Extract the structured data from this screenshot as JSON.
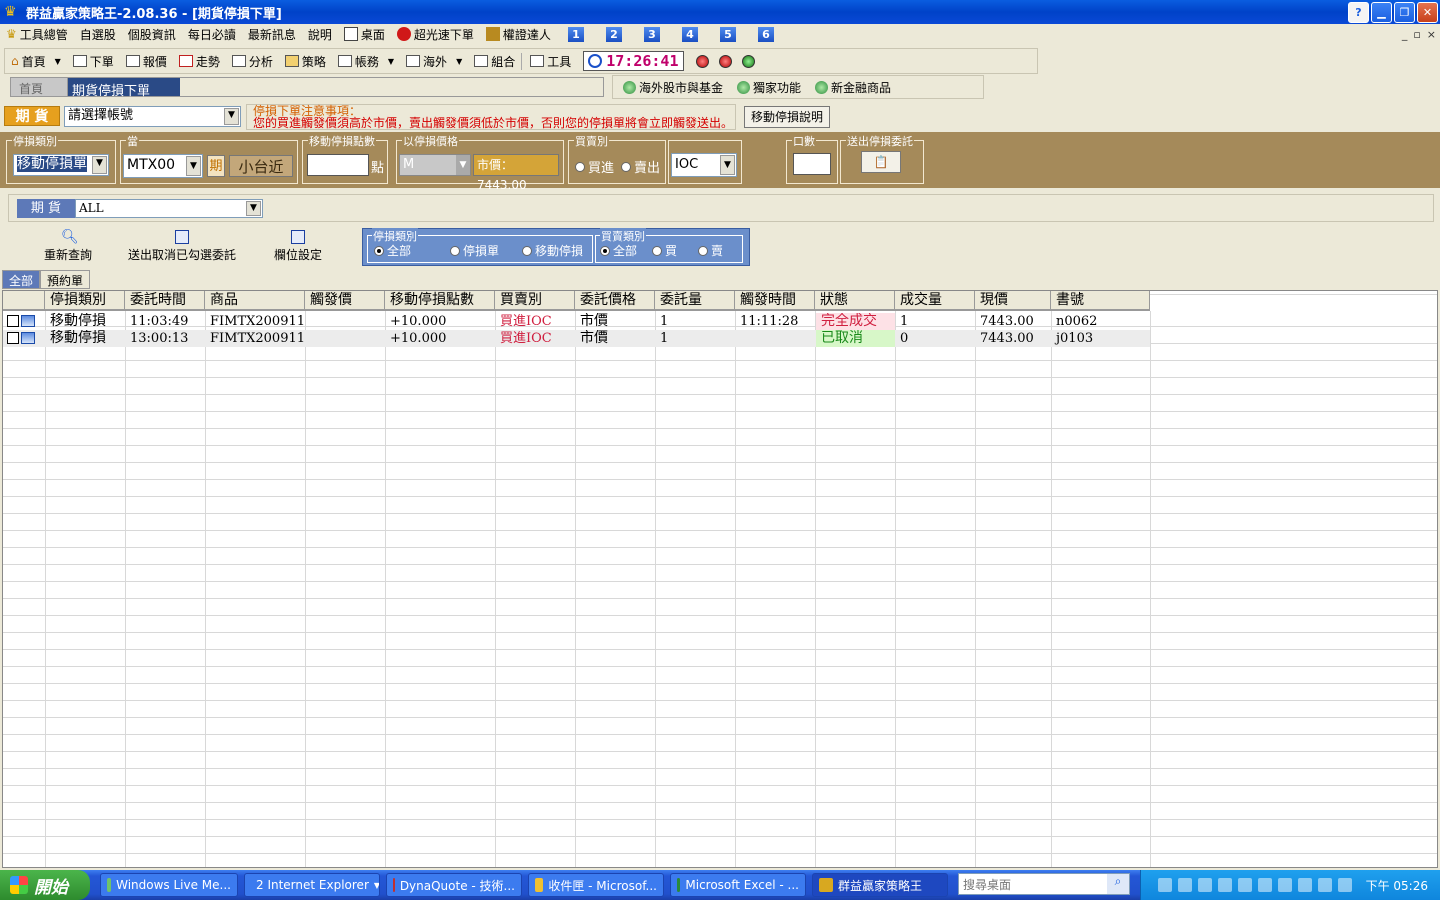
{
  "window": {
    "title": "群益贏家策略王-2.08.36 - [期貨停損下單]",
    "help": "?"
  },
  "menu": {
    "items": [
      "工具總管",
      "自選股",
      "個股資訊",
      "每日必讀",
      "最新訊息",
      "說明",
      "桌面",
      "超光速下單",
      "權證達人"
    ],
    "numbers": [
      "1",
      "2",
      "3",
      "4",
      "5",
      "6"
    ],
    "mdi": [
      "_",
      "▫",
      "×"
    ]
  },
  "toolbar": {
    "items": [
      "首頁",
      "下單",
      "報價",
      "走勢",
      "分析",
      "策略",
      "帳務",
      "海外",
      "組合",
      "工具"
    ],
    "clock": "17:26:41"
  },
  "tabs": {
    "home": "首頁",
    "active": "期貨停損下單"
  },
  "ext_links": [
    "海外股市與基金",
    "獨家功能",
    "新金融商品"
  ],
  "account": {
    "label": "期 貨",
    "select_value": "請選擇帳號",
    "notice_title": "停損下單注意事項：",
    "notice_body": "您的買進觸發價須高於市價，賣出觸發價須低於市價，否則您的停損單將會立即觸發送出。",
    "help_button": "移動停損說明"
  },
  "order": {
    "type_legend": "停損類別",
    "type_value": "移動停損單",
    "product_legend": "當",
    "product_value": "MTX00",
    "period_label": "期",
    "product_name": "小台近",
    "points_legend": "移動停損點數",
    "points_unit": "點",
    "price_legend": "以停損價格",
    "price_mode": "M",
    "market_price": "市價：7443.00",
    "side_legend": "買賣別",
    "buy": "買進",
    "sell": "賣出",
    "tif": "IOC",
    "qty_legend": "口數",
    "submit_legend": "送出停損委託"
  },
  "filter": {
    "label": "期 貨",
    "value": "ALL"
  },
  "actions": {
    "requery": "重新查詢",
    "cancel_selected": "送出取消已勾選委託",
    "columns": "欄位設定",
    "type_legend": "停損類別",
    "type_options": [
      "全部",
      "停損單",
      "移動停損"
    ],
    "side_legend": "買賣類別",
    "side_options": [
      "全部",
      "買",
      "賣"
    ]
  },
  "list_tabs": [
    "全部",
    "預約單"
  ],
  "grid": {
    "columns": [
      "停損類別",
      "委託時間",
      "商品",
      "觸發價",
      "移動停損點數",
      "買賣別",
      "委託價格",
      "委託量",
      "觸發時間",
      "狀態",
      "成交量",
      "現價",
      "書號"
    ],
    "rows": [
      [
        "移動停損",
        "11:03:49",
        "FIMTX200911",
        "",
        "+10.000",
        "買進IOC",
        "市價",
        "1",
        "11:11:28",
        "完全成交",
        "1",
        "7443.00",
        "n0062"
      ],
      [
        "移動停損",
        "13:00:13",
        "FIMTX200911",
        "",
        "+10.000",
        "買進IOC",
        "市價",
        "1",
        "",
        "已取消",
        "0",
        "7443.00",
        "j0103"
      ]
    ]
  },
  "taskbar": {
    "start": "開始",
    "tasks": [
      "Windows Live Me...",
      "2 Internet Explorer",
      "DynaQuote - 技術...",
      "收件匣 - Microsof...",
      "Microsoft Excel - ...",
      "群益贏家策略王"
    ],
    "search_placeholder": "搜尋桌面",
    "clock": "下午 05:26"
  },
  "colors": {
    "title_blue": "#0042c8",
    "brown_panel": "#a58a5a",
    "status_filled_bg": "#fde1e6",
    "status_cancel_bg": "#d7f7c8",
    "side_red": "#d02040"
  }
}
